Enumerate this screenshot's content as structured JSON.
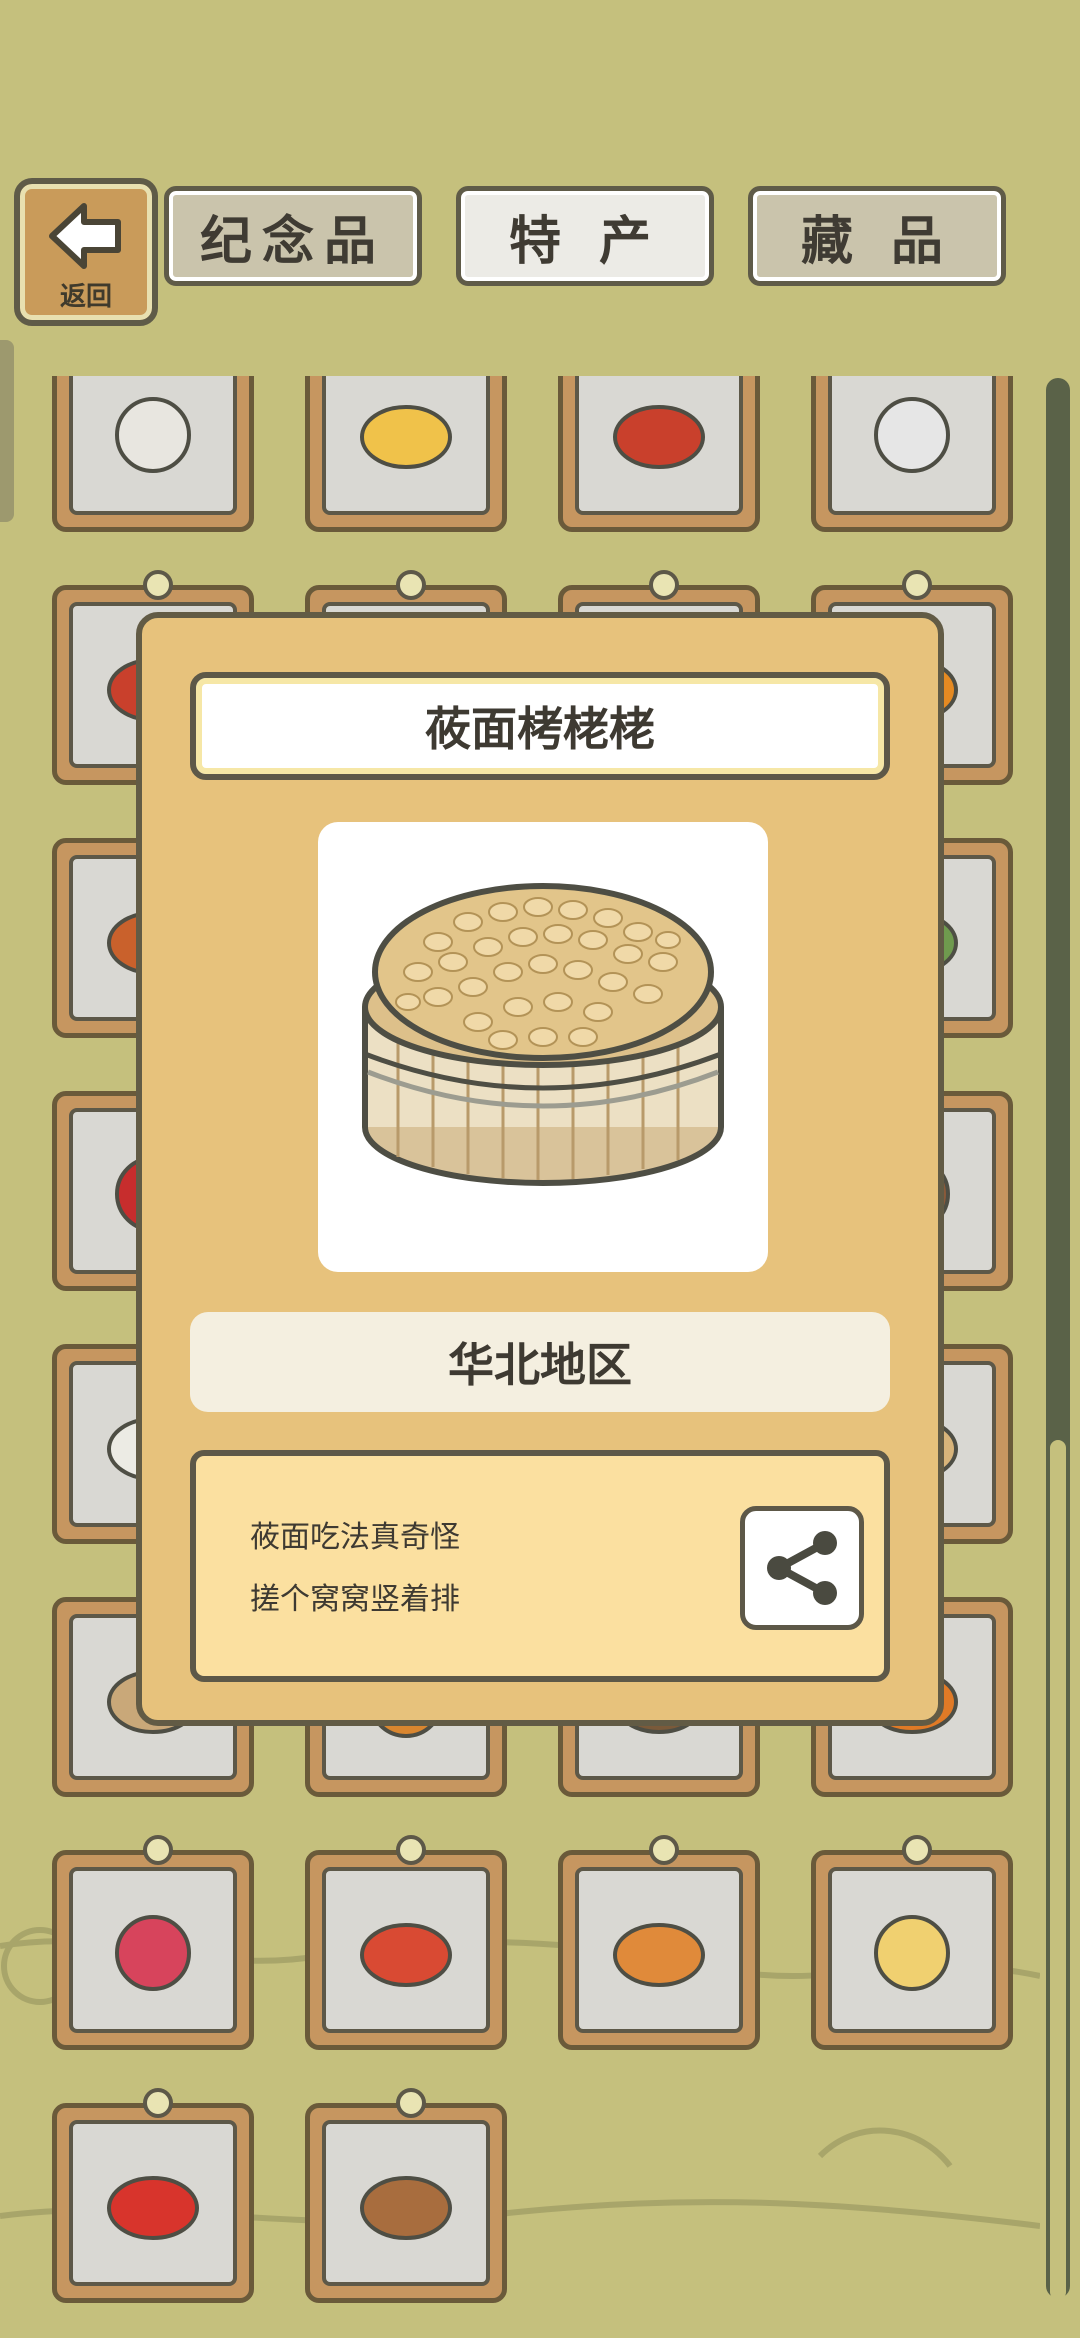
{
  "nav": {
    "back_label": "返回",
    "tabs": [
      {
        "label": "纪念品",
        "active": false
      },
      {
        "label": "特 产",
        "active": true
      },
      {
        "label": "藏 品",
        "active": false
      }
    ]
  },
  "grid": {
    "items": [
      {
        "name": "milk-jug"
      },
      {
        "name": "cheese"
      },
      {
        "name": "tea-can"
      },
      {
        "name": "glass-bottle"
      },
      {
        "name": "pizza"
      },
      {
        "name": "bread"
      },
      {
        "name": "dumplings"
      },
      {
        "name": "orange"
      },
      {
        "name": "curry"
      },
      {
        "name": "noodles"
      },
      {
        "name": "stew"
      },
      {
        "name": "leaf-dish"
      },
      {
        "name": "cherries"
      },
      {
        "name": "cake"
      },
      {
        "name": "candy"
      },
      {
        "name": "chocolate"
      },
      {
        "name": "cloth-bag"
      },
      {
        "name": "rice"
      },
      {
        "name": "basket"
      },
      {
        "name": "steamer"
      },
      {
        "name": "bread-plate"
      },
      {
        "name": "soup"
      },
      {
        "name": "pot"
      },
      {
        "name": "carrot"
      },
      {
        "name": "radish"
      },
      {
        "name": "tomatoes"
      },
      {
        "name": "pumpkins"
      },
      {
        "name": "shredded-food"
      },
      {
        "name": "apple"
      },
      {
        "name": "pancakes"
      }
    ]
  },
  "modal": {
    "title": "莜面栲栳栳",
    "item_icon": "steamer-basket-dumplings",
    "region": "华北地区",
    "description": [
      "莜面吃法真奇怪",
      "搓个窝窝竖着排"
    ],
    "share_icon": "share-icon"
  },
  "colors": {
    "background": "#c5c07d",
    "panel": "#e7c27c",
    "card_frame": "#c69660",
    "outline": "#5d5848"
  }
}
